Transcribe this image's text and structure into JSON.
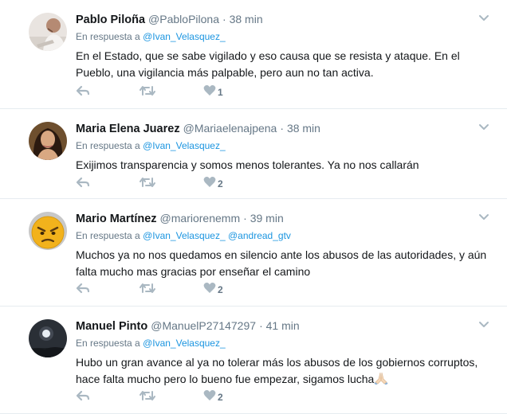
{
  "reply_prefix": "En respuesta a",
  "tweets": [
    {
      "name": "Pablo Piloña",
      "handle": "@PabloPilona",
      "time": "38 min",
      "reply_to": [
        "@Ivan_Velasquez_"
      ],
      "text": "En el Estado, que se sabe vigilado y eso causa que se resista y ataque. En el Pueblo, una vigilancia más palpable, pero aun no tan activa.",
      "likes": "1"
    },
    {
      "name": "Maria Elena Juarez",
      "handle": "@Mariaelenajpena",
      "time": "38 min",
      "reply_to": [
        "@Ivan_Velasquez_"
      ],
      "text": "Exijimos transparencia y somos menos tolerantes.  Ya no nos callarán",
      "likes": "2"
    },
    {
      "name": "Mario Martínez",
      "handle": "@mariorenemm",
      "time": "39 min",
      "reply_to": [
        "@Ivan_Velasquez_",
        "@andread_gtv"
      ],
      "text": "Muchos ya no nos quedamos en silencio ante los abusos de las autoridades, y aún falta mucho mas gracias por enseñar el camino",
      "likes": "2"
    },
    {
      "name": "Manuel Pinto",
      "handle": "@ManuelP27147297",
      "time": "41 min",
      "reply_to": [
        "@Ivan_Velasquez_"
      ],
      "text": "Hubo un gran avance al ya no tolerar más los abusos de los gobiernos corruptos, hace falta mucho pero lo bueno fue empezar, sigamos lucha",
      "likes": "2"
    }
  ],
  "colors": {
    "link": "#1b95e0",
    "muted": "#657786",
    "icon": "#aab8c2",
    "divider": "#e6ecf0"
  }
}
